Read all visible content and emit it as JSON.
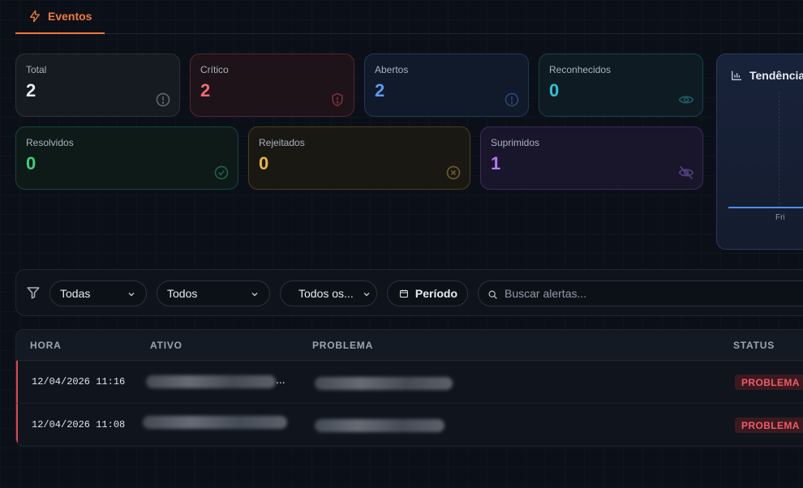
{
  "tabs": [
    {
      "label": "Eventos",
      "active": true
    }
  ],
  "stats": {
    "total": {
      "label": "Total",
      "value": "2"
    },
    "critical": {
      "label": "Crítico",
      "value": "2"
    },
    "open": {
      "label": "Abertos",
      "value": "2"
    },
    "acknowledged": {
      "label": "Reconhecidos",
      "value": "0"
    },
    "resolved": {
      "label": "Resolvidos",
      "value": "0"
    },
    "rejected": {
      "label": "Rejeitados",
      "value": "0"
    },
    "suppressed": {
      "label": "Suprimidos",
      "value": "1"
    }
  },
  "trend": {
    "title": "Tendência",
    "x_label": "Fri"
  },
  "filters": {
    "status_select": "Todas",
    "severity_select": "Todos",
    "type_select": "Todos os...",
    "period_label": "Período",
    "search_placeholder": "Buscar alertas..."
  },
  "table": {
    "columns": [
      "HORA",
      "ATIVO",
      "PROBLEMA",
      "STATUS"
    ],
    "rows": [
      {
        "time": "12/04/2026 11:16",
        "asset_suffix": "...",
        "status": "PROBLEMA"
      },
      {
        "time": "12/04/2026 11:08",
        "status": "PROBLEMA"
      }
    ]
  },
  "colors": {
    "accent": "#f07a3a",
    "critical": "#ef6b73",
    "open": "#5a9cf0",
    "acknowledged": "#2ec4d6",
    "resolved": "#3fcf7a",
    "rejected": "#e8b53e",
    "suppressed": "#b27af5"
  }
}
